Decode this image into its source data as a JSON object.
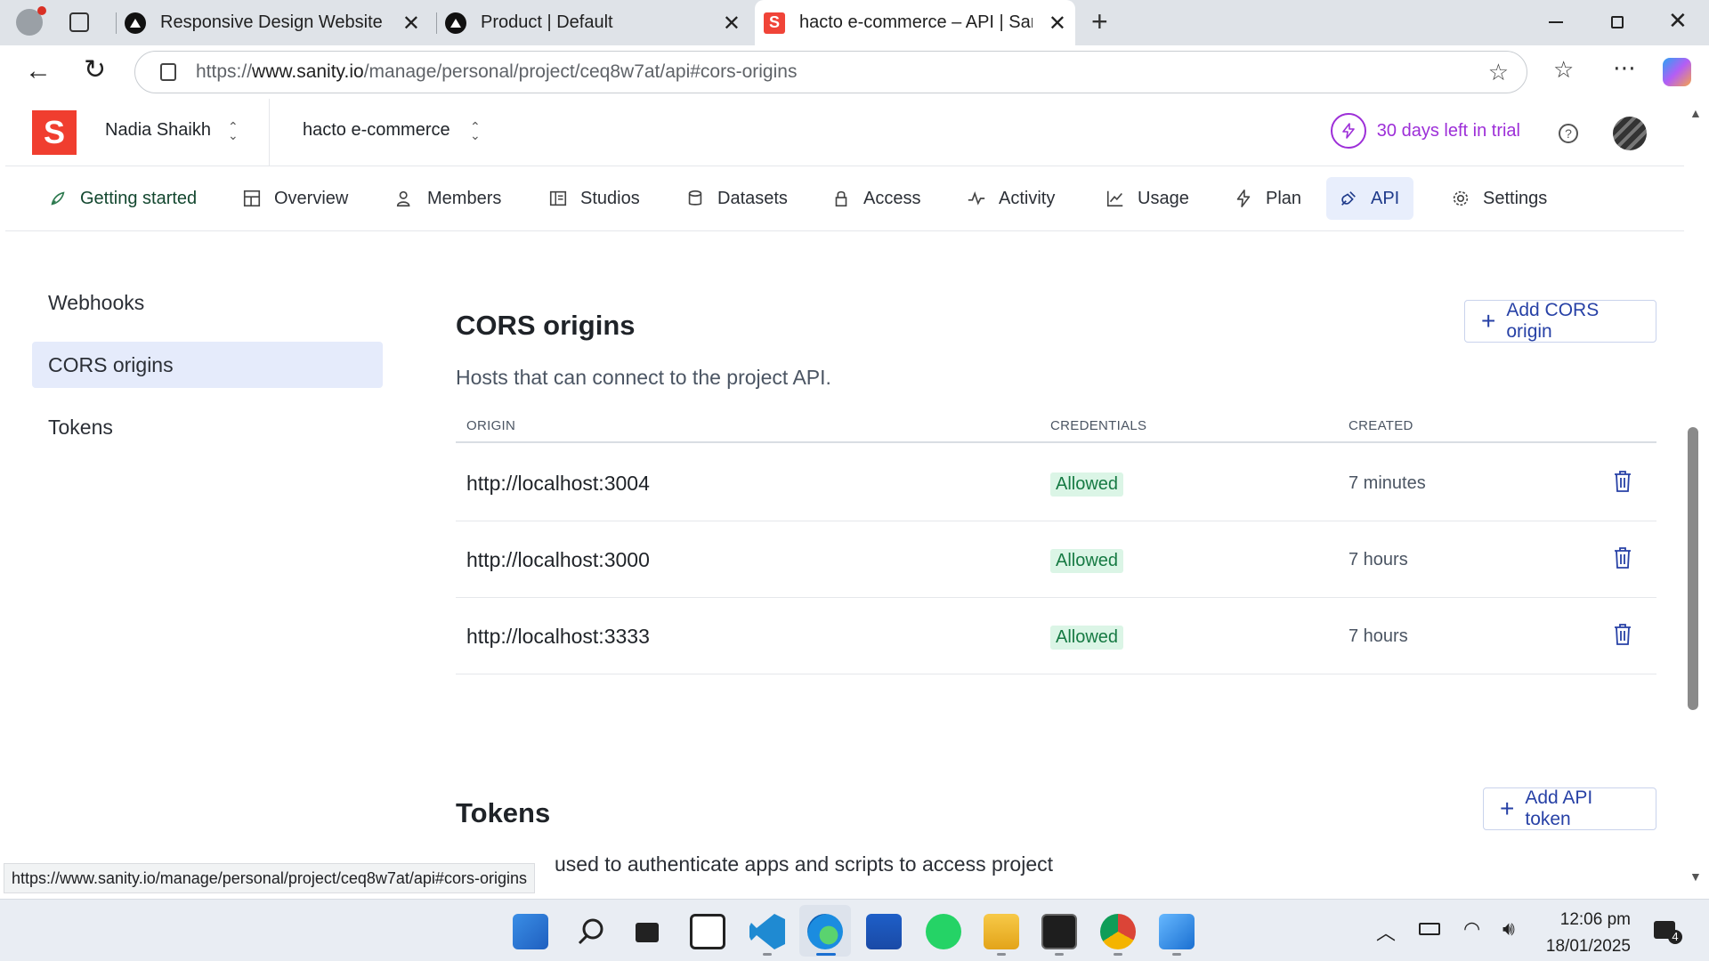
{
  "browser": {
    "tabs": [
      {
        "title": "Responsive Design Website"
      },
      {
        "title": "Product | Default"
      },
      {
        "title": "hacto e-commerce – API | Sanity.i"
      }
    ],
    "url_prefix": "https://",
    "url_host": "www.sanity.io",
    "url_path": "/manage/personal/project/ceq8w7at/api#cors-origins",
    "status_url": "https://www.sanity.io/manage/personal/project/ceq8w7at/api#cors-origins"
  },
  "header": {
    "logo_letter": "S",
    "user_name": "Nadia Shaikh",
    "project_name": "hacto e-commerce",
    "trial_text": "30 days left in trial"
  },
  "nav": [
    {
      "label": "Getting started",
      "icon": "rocket-icon"
    },
    {
      "label": "Overview",
      "icon": "layout-icon"
    },
    {
      "label": "Members",
      "icon": "users-icon"
    },
    {
      "label": "Studios",
      "icon": "studio-icon"
    },
    {
      "label": "Datasets",
      "icon": "database-icon"
    },
    {
      "label": "Access",
      "icon": "lock-icon"
    },
    {
      "label": "Activity",
      "icon": "activity-icon"
    },
    {
      "label": "Usage",
      "icon": "chart-icon"
    },
    {
      "label": "Plan",
      "icon": "bolt-icon"
    },
    {
      "label": "API",
      "icon": "plug-icon"
    },
    {
      "label": "Settings",
      "icon": "gear-icon"
    }
  ],
  "sidebar": {
    "items": [
      {
        "label": "Webhooks"
      },
      {
        "label": "CORS origins"
      },
      {
        "label": "Tokens"
      }
    ]
  },
  "cors": {
    "title": "CORS origins",
    "subtitle": "Hosts that can connect to the project API.",
    "add_button": "Add CORS origin",
    "columns": [
      "ORIGIN",
      "CREDENTIALS",
      "CREATED"
    ],
    "rows": [
      {
        "origin": "http://localhost:3004",
        "credentials": "Allowed",
        "created": "7 minutes"
      },
      {
        "origin": "http://localhost:3000",
        "credentials": "Allowed",
        "created": "7 hours"
      },
      {
        "origin": "http://localhost:3333",
        "credentials": "Allowed",
        "created": "7 hours"
      }
    ]
  },
  "tokens": {
    "title": "Tokens",
    "add_button": "Add API token",
    "description_visible": "used to authenticate apps and scripts to access project"
  },
  "taskbar": {
    "time": "12:06 pm",
    "date": "18/01/2025",
    "notification_count": "4"
  },
  "colors": {
    "brand": "#f03e2f",
    "accent": "#2741a6",
    "trial": "#9d2fd8",
    "allowed_bg": "#dbf5e6",
    "allowed_text": "#167a43"
  }
}
